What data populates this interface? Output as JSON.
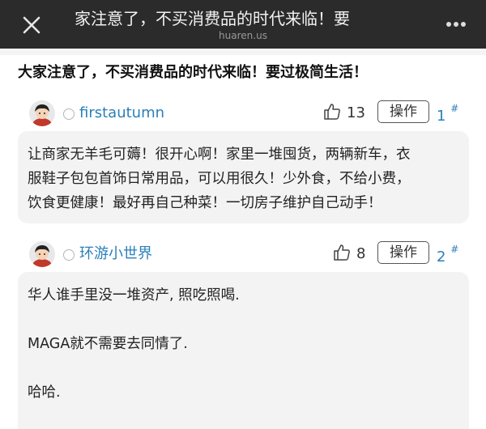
{
  "topbar": {
    "title": "家注意了，不买消费品的时代来临！要",
    "domain": "huaren.us",
    "close_icon": "close-icon",
    "more_icon": "more-dots-icon"
  },
  "post": {
    "title": "大家注意了，不买消费品的时代来临！要过极简生活！"
  },
  "comments": [
    {
      "username": "firstautumn",
      "likes": "13",
      "action_label": "操作",
      "floor": "1",
      "floor_mark": "#",
      "lines": [
        "让商家无羊毛可薅！很开心啊！家里一堆囤货，两辆新车，衣",
        "服鞋子包包首饰日常用品，可以用很久！少外食，不给小费，",
        "饮食更健康！最好再自己种菜！一切房子维护自己动手！"
      ]
    },
    {
      "username": "环游小世界",
      "likes": "8",
      "action_label": "操作",
      "floor": "2",
      "floor_mark": "#",
      "paragraphs": [
        "华人谁手里没一堆资产, 照吃照喝.",
        "MAGA就不需要去同情了.",
        "哈哈."
      ]
    }
  ],
  "colors": {
    "topbar_bg": "#2b2b2b",
    "link_blue": "#2a7fb8",
    "bubble_bg": "#f3f3f3"
  }
}
